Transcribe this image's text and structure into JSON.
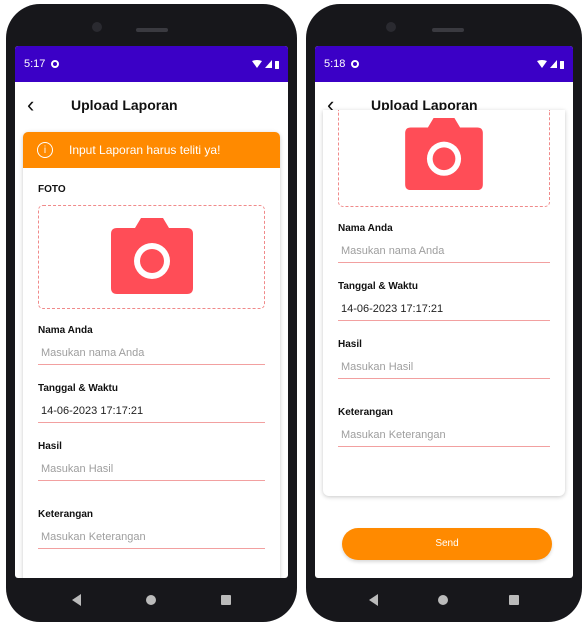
{
  "colors": {
    "accent": "#ff8a00",
    "statusbar": "#3b00c6",
    "camera": "#ff4d57",
    "underline": "#f2a0a0"
  },
  "left": {
    "status_time": "5:17",
    "title": "Upload Laporan",
    "banner": "Input Laporan harus teliti ya!",
    "foto_label": "FOTO",
    "nama_label": "Nama Anda",
    "nama_placeholder": "Masukan nama Anda",
    "tanggal_label": "Tanggal & Waktu",
    "tanggal_value": "14-06-2023 17:17:21",
    "hasil_label": "Hasil",
    "hasil_placeholder": "Masukan Hasil",
    "keterangan_label": "Keterangan",
    "keterangan_placeholder": "Masukan Keterangan"
  },
  "right": {
    "status_time": "5:18",
    "title": "Upload Laporan",
    "nama_label": "Nama Anda",
    "nama_placeholder": "Masukan nama Anda",
    "tanggal_label": "Tanggal & Waktu",
    "tanggal_value": "14-06-2023 17:17:21",
    "hasil_label": "Hasil",
    "hasil_placeholder": "Masukan Hasil",
    "keterangan_label": "Keterangan",
    "keterangan_placeholder": "Masukan Keterangan",
    "send_label": "Send"
  }
}
